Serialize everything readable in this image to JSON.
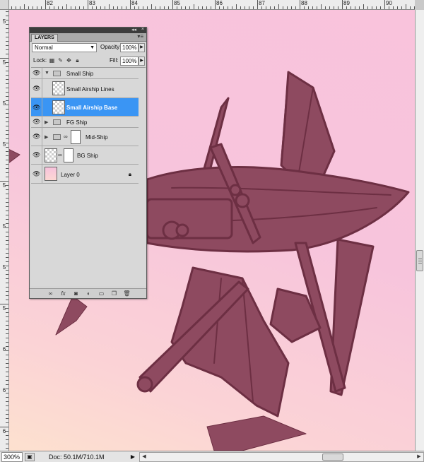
{
  "ruler": {
    "top_labels": [
      "82",
      "83",
      "84",
      "85",
      "86",
      "87",
      "88",
      "89",
      "90"
    ],
    "left_labels": [
      "5",
      "5",
      "5",
      "5",
      "5",
      "5",
      "5",
      "5",
      "6",
      "6",
      "6"
    ]
  },
  "layers_panel": {
    "tab_label": "LAYERS",
    "collapse_glyph": "◂◂",
    "close_glyph": "×",
    "menu_glyph": "▾≡",
    "blend_mode": "Normal",
    "opacity_label": "Opacity:",
    "opacity_value": "100%",
    "lock_label": "Lock:",
    "fill_label": "Fill:",
    "fill_value": "100%",
    "layers": [
      {
        "name": "Small Ship",
        "kind": "group",
        "expanded": true
      },
      {
        "name": "Small Airship Lines",
        "kind": "layer"
      },
      {
        "name": "Small Airship Base",
        "kind": "layer",
        "selected": true
      },
      {
        "name": "FG Ship",
        "kind": "group",
        "expanded": false
      },
      {
        "name": "Mid-Ship",
        "kind": "group-masked",
        "expanded": false
      },
      {
        "name": "BG Ship",
        "kind": "layer-masked"
      },
      {
        "name": "Layer 0",
        "kind": "background",
        "locked": true
      }
    ],
    "bottom_icons": [
      "link-layers-icon",
      "fx-icon",
      "add-mask-icon",
      "adjustment-icon",
      "new-group-icon",
      "new-layer-icon",
      "trash-icon"
    ]
  },
  "status": {
    "zoom": "300%",
    "doc_info": "Doc: 50.1M/710.1M"
  },
  "colors": {
    "airship": "#8e4a60",
    "airship_line": "#6d2f43",
    "selected_layer": "#3a95f4"
  }
}
